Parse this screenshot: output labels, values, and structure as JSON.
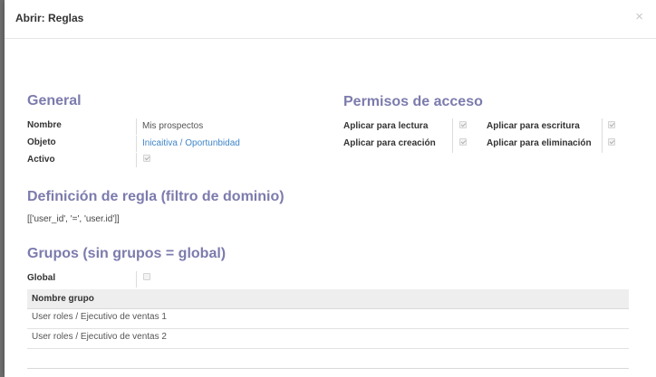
{
  "modal": {
    "title": "Abrir: Reglas",
    "close_label": "×"
  },
  "general": {
    "title": "General",
    "name_label": "Nombre",
    "name_value": "Mis prospectos",
    "object_label": "Objeto",
    "object_value": "Inicaitiva / Oportunbidad",
    "active_label": "Activo",
    "active_checked": true
  },
  "access": {
    "title": "Permisos de acceso",
    "read_label": "Aplicar para lectura",
    "read_checked": true,
    "write_label": "Aplicar para escritura",
    "write_checked": true,
    "create_label": "Aplicar para creación",
    "create_checked": true,
    "delete_label": "Aplicar para eliminación",
    "delete_checked": true
  },
  "domain": {
    "title": "Definición de regla (filtro de dominio)",
    "value": "[['user_id', '=', 'user.id']]"
  },
  "groups": {
    "title": "Grupos (sin grupos = global)",
    "global_label": "Global",
    "global_checked": false,
    "table_header": "Nombre grupo",
    "rows": [
      "User roles / Ejecutivo de ventas 1",
      "User roles / Ejecutivo de ventas 2"
    ]
  }
}
